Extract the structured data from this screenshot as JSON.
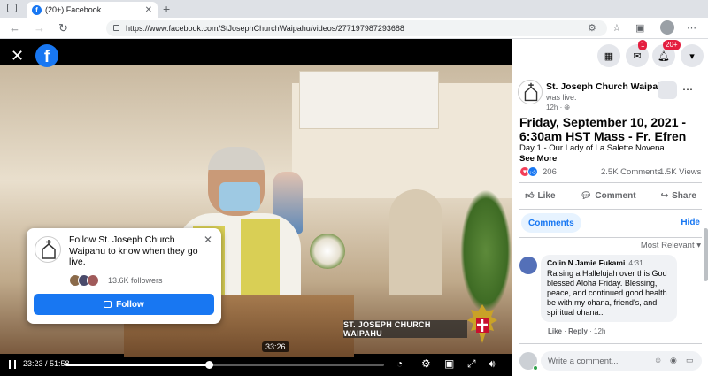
{
  "browser": {
    "tab_title": "(20+) Facebook",
    "tab_close": "✕",
    "new_tab": "+",
    "url": "https://www.facebook.com/StJosephChurchWaipahu/videos/277197987293688"
  },
  "video": {
    "fb_logo": "f",
    "lower_third": "ST. JOSEPH CHURCH WAIPAHU",
    "hover_time": "33:26",
    "time_display": "23:23 / 51:58",
    "progress_fraction": 0.45,
    "follow_card": {
      "text": "Follow St. Joseph Church Waipahu to know when they go live.",
      "followers": "13.6K followers",
      "button": "Follow"
    }
  },
  "top_nav": {
    "messenger_badge": "1",
    "notifications_badge": "20+"
  },
  "post": {
    "page_name": "St. Joseph Church Waipahu",
    "status": "was live.",
    "timestamp": "12h · ",
    "title": "Friday, September 10, 2021 - 6:30am HST Mass - Fr. Efren",
    "body": "Day 1 - Our Lady of La Salette Novena...",
    "see_more": "See More",
    "reaction_count": "206",
    "comments_count": "2.5K Comments",
    "shares_count": "1.5K Views",
    "actions": {
      "like": "Like",
      "comment": "Comment",
      "share": "Share"
    }
  },
  "comments_panel": {
    "tab_comments": "Comments",
    "hide": "Hide",
    "sort": "Most Relevant ▾",
    "comment": {
      "author": "Colin N Jamie Fukami",
      "duration": "4:31",
      "text": "Raising a Hallelujah over this God blessed Aloha Friday. Blessing, peace, and continued good health be with my ohana, friend's, and spiritual ohana..",
      "meta_like": "Like",
      "meta_reply": "Reply",
      "meta_time": "12h"
    },
    "composer_placeholder": "Write a comment..."
  },
  "colors": {
    "facebook_blue": "#1877f2",
    "badge_red": "#e41e3f"
  }
}
